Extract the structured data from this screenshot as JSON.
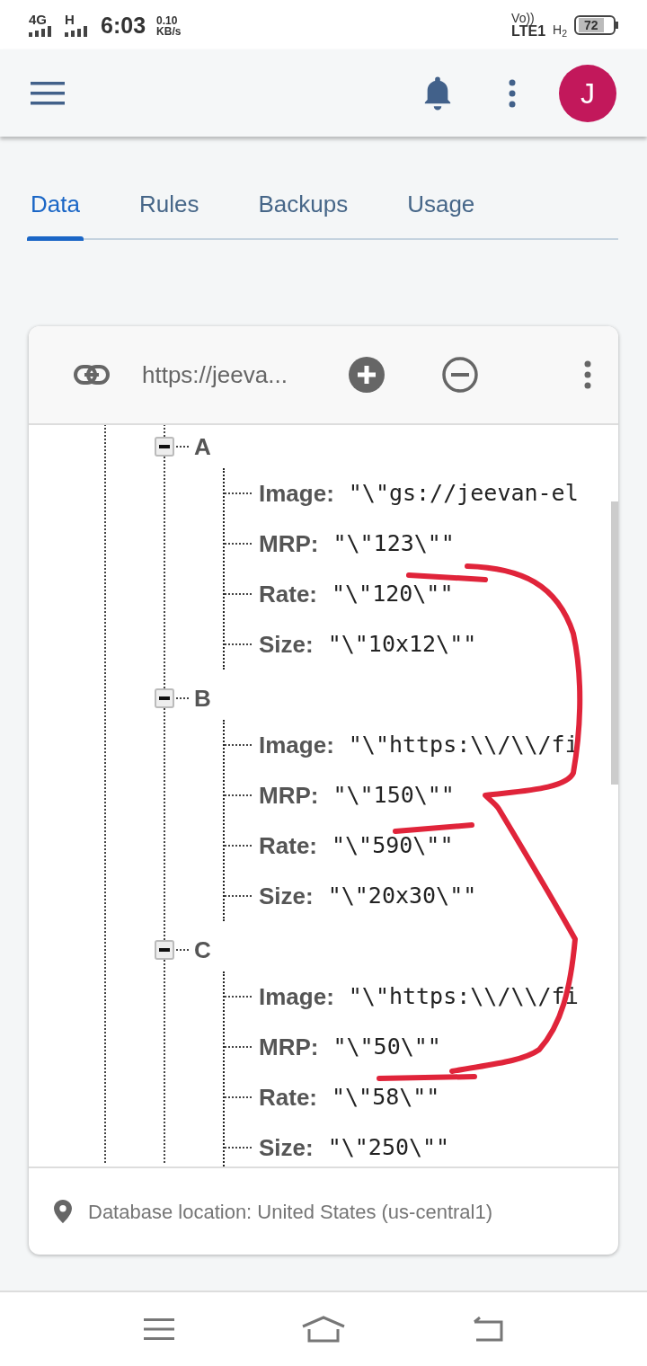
{
  "status_bar": {
    "network": "4G",
    "network_2": "H",
    "time": "6:03",
    "speed": "0.10",
    "speed_unit": "KB/s",
    "volte": "Vo))",
    "lte": "LTE1",
    "h_plus": "H$_{2}$",
    "battery": "72"
  },
  "app_bar": {
    "avatar": "J"
  },
  "tabs": [
    {
      "label": "Data",
      "selected": true
    },
    {
      "label": "Rules",
      "selected": false
    },
    {
      "label": "Backups",
      "selected": false
    },
    {
      "label": "Usage",
      "selected": false
    }
  ],
  "toolbar": {
    "url": "https://jeeva..."
  },
  "tree": [
    {
      "key": "A",
      "expanded": true,
      "children": [
        {
          "key": "Image:",
          "value": "\"\\\"gs://jeevan-el"
        },
        {
          "key": "MRP:",
          "value": "\"\\\"123\\\"\""
        },
        {
          "key": "Rate:",
          "value": "\"\\\"120\\\"\""
        },
        {
          "key": "Size:",
          "value": "\"\\\"10x12\\\"\""
        }
      ]
    },
    {
      "key": "B",
      "expanded": true,
      "children": [
        {
          "key": "Image:",
          "value": "\"\\\"https:\\\\/\\\\/fi"
        },
        {
          "key": "MRP:",
          "value": "\"\\\"150\\\"\""
        },
        {
          "key": "Rate:",
          "value": "\"\\\"590\\\"\""
        },
        {
          "key": "Size:",
          "value": "\"\\\"20x30\\\"\""
        }
      ]
    },
    {
      "key": "C",
      "expanded": true,
      "children": [
        {
          "key": "Image:",
          "value": "\"\\\"https:\\\\/\\\\/fi"
        },
        {
          "key": "MRP:",
          "value": "\"\\\"50\\\"\""
        },
        {
          "key": "Rate:",
          "value": "\"\\\"58\\\"\""
        },
        {
          "key": "Size:",
          "value": "\"\\\"250\\\"\""
        }
      ]
    }
  ],
  "footer": {
    "location": "Database location: United States (us-central1)"
  }
}
